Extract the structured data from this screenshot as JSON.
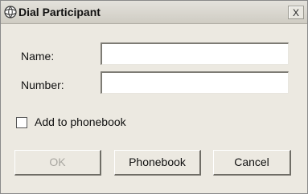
{
  "window": {
    "title": "Dial Participant",
    "close_label": "X"
  },
  "form": {
    "name_label": "Name:",
    "name_value": "",
    "number_label": "Number:",
    "number_value": "",
    "add_to_phonebook_label": "Add to phonebook",
    "add_to_phonebook_checked": false
  },
  "buttons": {
    "ok_label": "OK",
    "phonebook_label": "Phonebook",
    "cancel_label": "Cancel"
  },
  "icons": {
    "app": "globe-icon",
    "close": "close-icon"
  }
}
